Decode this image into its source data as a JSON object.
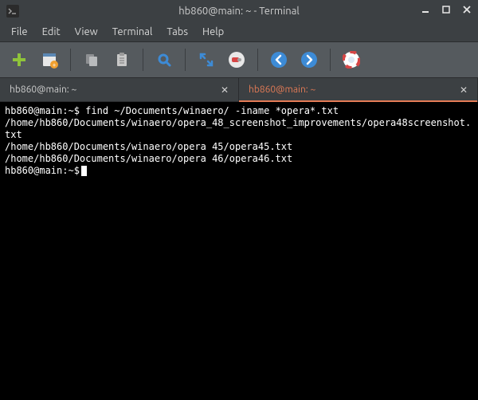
{
  "window": {
    "title": "hb860@main: ~ - Terminal"
  },
  "menu": {
    "file": "File",
    "edit": "Edit",
    "view": "View",
    "terminal": "Terminal",
    "tabs": "Tabs",
    "help": "Help"
  },
  "tabs": [
    {
      "label": "hb860@main: ~",
      "active": false
    },
    {
      "label": "hb860@main: ~",
      "active": true
    }
  ],
  "terminal": {
    "prompt": "hb860@main:~$",
    "command": "find ~/Documents/winaero/ -iname *opera*.txt",
    "output": [
      "/home/hb860/Documents/winaero/opera_48_screenshot_improvements/opera48screenshot.txt",
      "/home/hb860/Documents/winaero/opera 45/opera45.txt",
      "/home/hb860/Documents/winaero/opera 46/opera46.txt"
    ]
  },
  "icons": {
    "new_tab": "new-tab-icon",
    "new_window": "new-window-icon",
    "copy": "copy-icon",
    "paste": "paste-icon",
    "search": "search-icon",
    "fullscreen": "fullscreen-icon",
    "prefs": "preferences-icon",
    "back": "back-icon",
    "forward": "forward-icon",
    "help": "help-icon"
  },
  "colors": {
    "accent": "#e47b56",
    "chrome_bg": "#3c4043",
    "toolbar_bg": "#555a5e",
    "terminal_bg": "#000000",
    "terminal_fg": "#ffffff"
  }
}
